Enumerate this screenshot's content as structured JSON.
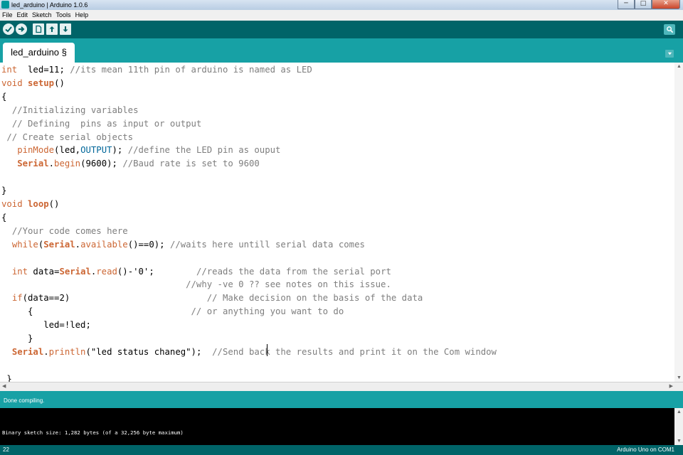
{
  "window": {
    "title": "led_arduino | Arduino 1.0.6",
    "minimize": "─",
    "maximize": "□",
    "close": "✕"
  },
  "menu": [
    "File",
    "Edit",
    "Sketch",
    "Tools",
    "Help"
  ],
  "toolbar": {
    "icons": [
      "verify-icon",
      "upload-icon",
      "new-icon",
      "open-icon",
      "save-icon"
    ],
    "serial_icon": "serial-monitor-icon",
    "background": "#006468"
  },
  "tab": {
    "label": "led_arduino §",
    "menu_icon": "tab-menu-icon"
  },
  "editor": {
    "lines": [
      [
        [
          "kw",
          "int"
        ],
        [
          "",
          "  led=11; "
        ],
        [
          "cm",
          "//its mean 11th pin of arduino is named as LED"
        ]
      ],
      [
        [
          "kw",
          "void"
        ],
        [
          "",
          " "
        ],
        [
          "fn",
          "setup"
        ],
        [
          "",
          "()"
        ]
      ],
      [
        [
          "",
          "{"
        ]
      ],
      [
        [
          "",
          "  "
        ],
        [
          "cm",
          "//Initializing variables"
        ]
      ],
      [
        [
          "",
          "  "
        ],
        [
          "cm",
          "// Defining  pins as input or output"
        ]
      ],
      [
        [
          "",
          ""
        ],
        [
          "cm",
          " // Create serial objects"
        ]
      ],
      [
        [
          "",
          "   "
        ],
        [
          "kw",
          "pinMode"
        ],
        [
          "",
          "(led,"
        ],
        [
          "const",
          "OUTPUT"
        ],
        [
          "",
          "); "
        ],
        [
          "cm",
          "//define the LED pin as ouput"
        ]
      ],
      [
        [
          "",
          "   "
        ],
        [
          "fn",
          "Serial"
        ],
        [
          "",
          "."
        ],
        [
          "kw",
          "begin"
        ],
        [
          "",
          "(9600); "
        ],
        [
          "cm",
          "//Baud rate is set to 9600"
        ]
      ],
      [
        [
          "",
          ""
        ]
      ],
      [
        [
          "",
          "}"
        ]
      ],
      [
        [
          "kw",
          "void"
        ],
        [
          "",
          " "
        ],
        [
          "fn",
          "loop"
        ],
        [
          "",
          "()"
        ]
      ],
      [
        [
          "",
          "{"
        ]
      ],
      [
        [
          "",
          "  "
        ],
        [
          "cm",
          "//Your code comes here"
        ]
      ],
      [
        [
          "",
          "  "
        ],
        [
          "kw",
          "while"
        ],
        [
          "",
          "("
        ],
        [
          "fn",
          "Serial"
        ],
        [
          "",
          "."
        ],
        [
          "kw",
          "available"
        ],
        [
          "",
          "()==0); "
        ],
        [
          "cm",
          "//waits here untill serial data comes"
        ]
      ],
      [
        [
          "",
          ""
        ]
      ],
      [
        [
          "",
          "  "
        ],
        [
          "kw",
          "int"
        ],
        [
          "",
          " data="
        ],
        [
          "fn",
          "Serial"
        ],
        [
          "",
          "."
        ],
        [
          "kw",
          "read"
        ],
        [
          "",
          "()-'0';        "
        ],
        [
          "cm",
          "//reads the data from the serial port"
        ]
      ],
      [
        [
          "",
          "                                   "
        ],
        [
          "cm",
          "//why -ve 0 ?? see notes on this issue."
        ]
      ],
      [
        [
          "",
          "  "
        ],
        [
          "kw",
          "if"
        ],
        [
          "",
          "(data==2)                          "
        ],
        [
          "cm",
          "// Make decision on the basis of the data"
        ]
      ],
      [
        [
          "",
          "     {                              "
        ],
        [
          "cm",
          "// or anything you want to do"
        ]
      ],
      [
        [
          "",
          "        led=!led;"
        ]
      ],
      [
        [
          "",
          "     }"
        ]
      ],
      [
        [
          "",
          "  "
        ],
        [
          "fn",
          "Serial"
        ],
        [
          "",
          "."
        ],
        [
          "kw",
          "println"
        ],
        [
          "",
          "(\"led status chaneg\");  "
        ],
        [
          "cm",
          "//Send back the results and print it on the Com window"
        ]
      ],
      [
        [
          "",
          ""
        ]
      ],
      [
        [
          "",
          ""
        ],
        [
          "",
          " }"
        ]
      ]
    ]
  },
  "status": {
    "message": "Done compiling."
  },
  "console": {
    "output": "Binary sketch size: 1,282 bytes (of a 32,256 byte maximum)"
  },
  "footer": {
    "line_number": "22",
    "board": "Arduino Uno on COM1"
  },
  "colors": {
    "teal_dark": "#006468",
    "teal": "#17a1a5",
    "keyword": "#cc6633",
    "constant": "#006699",
    "comment": "#7e7e7e"
  }
}
